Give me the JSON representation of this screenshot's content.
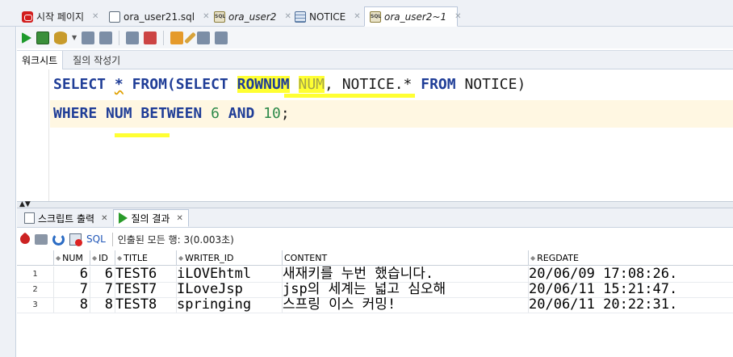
{
  "tabs": [
    {
      "icon": "start-page-icon",
      "label": "시작 페이지",
      "italic": false,
      "active": false
    },
    {
      "icon": "sql-file-icon",
      "label": "ora_user21.sql",
      "italic": false,
      "active": false
    },
    {
      "icon": "sql-worksheet-icon",
      "label": "ora_user2",
      "italic": true,
      "active": false
    },
    {
      "icon": "table-icon",
      "label": "NOTICE",
      "italic": false,
      "active": false
    },
    {
      "icon": "sql-worksheet-icon",
      "label": "ora_user2~1",
      "italic": true,
      "active": true
    }
  ],
  "worksheet_tabs": {
    "worksheet": "워크시트",
    "query_builder": "질의 작성기"
  },
  "sql": {
    "line1": {
      "t1": "SELECT",
      "t2": "*",
      "t3": "FROM(SELECT",
      "t4": "ROWNUM",
      "t5": "NUM",
      "t6": ",",
      "t7": "NOTICE.*",
      "t8": "FROM",
      "t9": "NOTICE)"
    },
    "line2": {
      "t1": "WHERE",
      "t2": "NUM",
      "t3": "BETWEEN",
      "t4": "6",
      "t5": "AND",
      "t6": "10",
      "t7": ";"
    }
  },
  "result_tabs": {
    "script_output": "스크립트 출력",
    "query_result": "질의 결과"
  },
  "result_toolbar": {
    "sql_link": "SQL",
    "info": "인출된 모든 행: 3(0.003초)"
  },
  "grid": {
    "columns": [
      "NUM",
      "ID",
      "TITLE",
      "WRITER_ID",
      "CONTENT",
      "REGDATE"
    ],
    "rows": [
      {
        "rownum": "1",
        "num": "6",
        "id": "6",
        "title": "TEST6",
        "writer": "iLOVEhtml",
        "content": "새재키를 누번 했습니다.",
        "regdate": "20/06/09 17:08:26."
      },
      {
        "rownum": "2",
        "num": "7",
        "id": "7",
        "title": "TEST7",
        "writer": "ILoveJsp",
        "content": "jsp의 세계는 넓고 심오해",
        "regdate": "20/06/11 15:21:47."
      },
      {
        "rownum": "3",
        "num": "8",
        "id": "8",
        "title": "TEST8",
        "writer": "springing",
        "content": "스프링 이스 커밍!",
        "regdate": "20/06/11 20:22:31."
      }
    ]
  },
  "colors": {
    "keyword": "#1f3d97",
    "number": "#2e8a4a",
    "highlight": "#ffff33",
    "current_line": "#fff7e2"
  }
}
